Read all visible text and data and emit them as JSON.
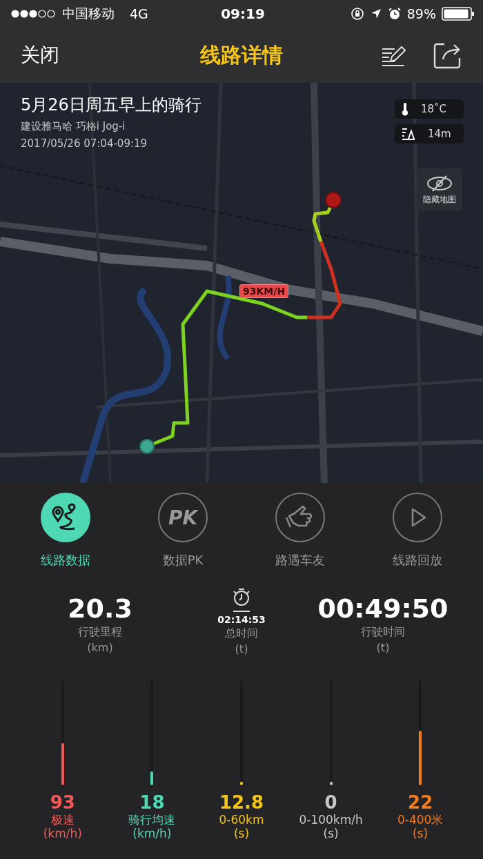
{
  "status_bar": {
    "carrier": "中国移动",
    "network": "4G",
    "time": "09:19",
    "battery": "89%"
  },
  "nav": {
    "close": "关闭",
    "title": "线路详情"
  },
  "ride": {
    "title": "5月26日周五早上的骑行",
    "vehicle": "建设雅马哈 巧格i Jog-i",
    "time_range": "2017/05/26 07:04-09:19"
  },
  "weather": {
    "temperature": "18˚C",
    "altitude": "14m"
  },
  "map": {
    "hide_button": "隐藏地图",
    "speed_callout": "93KM/H"
  },
  "tabs": [
    {
      "kind": "route",
      "label": "线路数据",
      "selected": true
    },
    {
      "kind": "pk",
      "label": "数据PK",
      "icon_text": "PK",
      "selected": false
    },
    {
      "kind": "thumb",
      "label": "路遇车友",
      "selected": false
    },
    {
      "kind": "play",
      "label": "线路回放",
      "selected": false
    }
  ],
  "stats": {
    "distance": {
      "value": "20.3",
      "label": "行驶里程",
      "unit": "(km)"
    },
    "total_time": {
      "value": "02:14:53",
      "label": "总时间",
      "unit": "(t)"
    },
    "drive_time": {
      "value": "00:49:50",
      "label": "行驶时间",
      "unit": "(t)"
    }
  },
  "gauges": [
    {
      "value": "93",
      "label": "极速",
      "unit": "(km/h)",
      "level": 0.4,
      "color": "#f25a5a"
    },
    {
      "value": "18",
      "label": "骑行均速",
      "unit": "(km/h)",
      "level": 0.13,
      "color": "#4fd8b4"
    },
    {
      "value": "12.8",
      "label": "0-60km",
      "unit": "(s)",
      "level": 0.02,
      "color": "#f5c518"
    },
    {
      "value": "0",
      "label": "0-100km/h",
      "unit": "(s)",
      "level": 0.02,
      "color": "#c8c8c8"
    },
    {
      "value": "22",
      "label": "0-400米",
      "unit": "(s)",
      "level": 0.52,
      "color": "#f57c1f"
    }
  ]
}
